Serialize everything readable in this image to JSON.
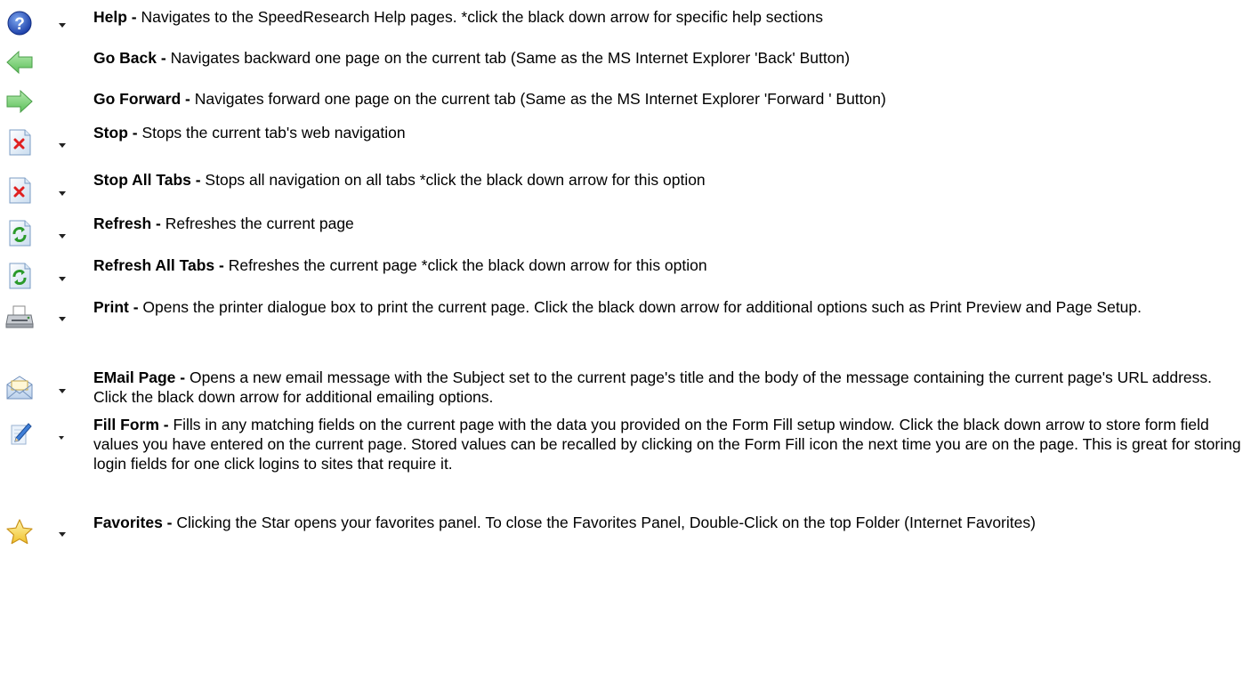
{
  "items": [
    {
      "icon": "help-icon",
      "has_dropdown": true,
      "title": "Help - ",
      "description": "Navigates to the SpeedResearch Help pages.  *click the black down arrow for specific help sections"
    },
    {
      "icon": "go-back-arrow-icon",
      "has_dropdown": false,
      "title": "Go Back - ",
      "description": "Navigates backward one page on the current tab (Same as the MS Internet Explorer 'Back' Button)"
    },
    {
      "icon": "go-forward-arrow-icon",
      "has_dropdown": false,
      "title": "Go Forward - ",
      "description": "Navigates forward one page on the current tab (Same as the MS Internet Explorer 'Forward ' Button)"
    },
    {
      "icon": "stop-icon",
      "has_dropdown": true,
      "title": "Stop - ",
      "description": "Stops the current tab's web navigation"
    },
    {
      "icon": "stop-all-icon",
      "has_dropdown": true,
      "title": "Stop All Tabs - ",
      "description": "Stops all navigation on all tabs  *click the black down arrow for this option"
    },
    {
      "icon": "refresh-icon",
      "has_dropdown": true,
      "title": "Refresh - ",
      "description": "Refreshes the current page"
    },
    {
      "icon": "refresh-all-icon",
      "has_dropdown": true,
      "title": "Refresh All Tabs - ",
      "description": "Refreshes the current page  *click the black down arrow for this option"
    },
    {
      "icon": "printer-icon",
      "has_dropdown": true,
      "title": "Print - ",
      "description": "Opens the printer dialogue box to print the current page.  Click the black down arrow for additional options such as Print Preview and Page Setup."
    },
    {
      "icon": "email-envelope-icon",
      "has_dropdown": true,
      "title": "EMail Page - ",
      "description": "Opens a new email message with the Subject set to the current page's title and the body of the message containing the current page's URL address.  Click the black down arrow for additional emailing options."
    },
    {
      "icon": "fill-form-pencil-icon",
      "has_dropdown": true,
      "title": "Fill Form - ",
      "description": "Fills in any matching fields on the current page with the data you provided on the Form Fill setup window.  Click the black down arrow to store form field values you have entered on the current page.  Stored values can be recalled by clicking on the Form Fill icon the next time you are on the page.  This is great for storing login fields for one click logins to sites that require it."
    },
    {
      "icon": "favorites-star-icon",
      "has_dropdown": true,
      "title": "Favorites  - ",
      "description": "Clicking the Star opens your favorites panel.  To close the Favorites Panel, Double-Click on the top Folder (Internet Favorites)"
    }
  ]
}
